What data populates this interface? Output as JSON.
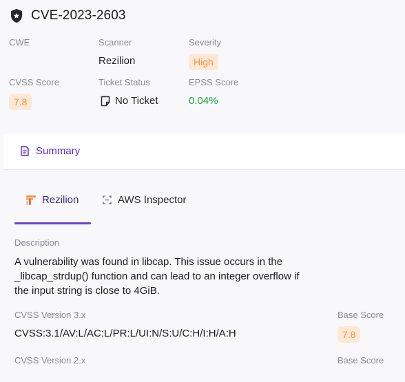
{
  "header": {
    "title": "CVE-2023-2603",
    "cwe_label": "CWE",
    "scanner_label": "Scanner",
    "scanner_value": "Rezilion",
    "severity_label": "Severity",
    "severity_value": "High",
    "cvss_label": "CVSS Score",
    "cvss_value": "7.8",
    "ticket_label": "Ticket Status",
    "ticket_value": "No Ticket",
    "epss_label": "EPSS Score",
    "epss_value": "0.04%"
  },
  "summary_tab": {
    "label": "Summary"
  },
  "vendor_tabs": [
    {
      "label": "Rezilion",
      "active": true
    },
    {
      "label": "AWS Inspector",
      "active": false
    }
  ],
  "details": {
    "description_label": "Description",
    "description": "A vulnerability was found in libcap. This issue occurs in the _libcap_strdup() function and can lead to an integer overflow if the input string is close to 4GiB.",
    "cvss3_label": "CVSS Version 3.x",
    "cvss3_vector": "CVSS:3.1/AV:L/AC:L/PR:L/UI:N/S:U/C:H/I:H/A:H",
    "base_score_label": "Base Score",
    "base_score_value": "7.8",
    "cvss2_label": "CVSS Version 2.x",
    "base_score2_label": "Base Score"
  },
  "colors": {
    "accent": "#5c2cc9",
    "severity_bg": "#fde8d6",
    "severity_text": "#f19243",
    "epss": "#1aa64a"
  }
}
